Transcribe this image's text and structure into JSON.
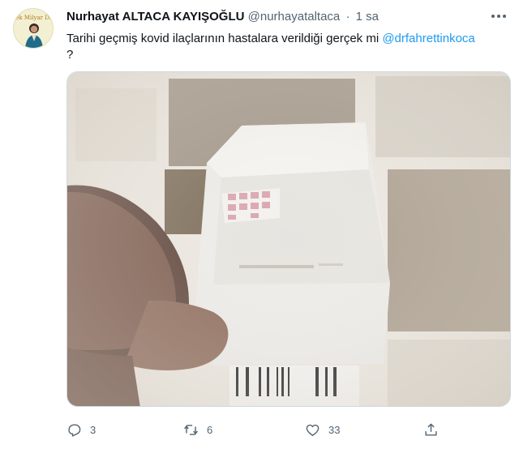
{
  "tweet": {
    "author_name": "Nurhayat ALTACA KAYIŞOĞLU",
    "handle": "@nurhayataltaca",
    "separator": "·",
    "time": "1 sa",
    "text_before": "Tarihi geçmiş kovid ilaçlarının hastalara verildiği gerçek mi ",
    "mention": "@drfahrettinkoca",
    "text_after": "?",
    "avatar_text": "Tek Milyar Dişi"
  },
  "actions": {
    "reply_count": "3",
    "retweet_count": "6",
    "like_count": "33"
  },
  "icons": {
    "more": "more-horizontal-icon",
    "reply": "reply-icon",
    "retweet": "retweet-icon",
    "like": "heart-icon",
    "share": "share-icon"
  },
  "colors": {
    "link": "#1d9bf0",
    "secondary_text": "#536471",
    "border": "#cfd9de"
  }
}
